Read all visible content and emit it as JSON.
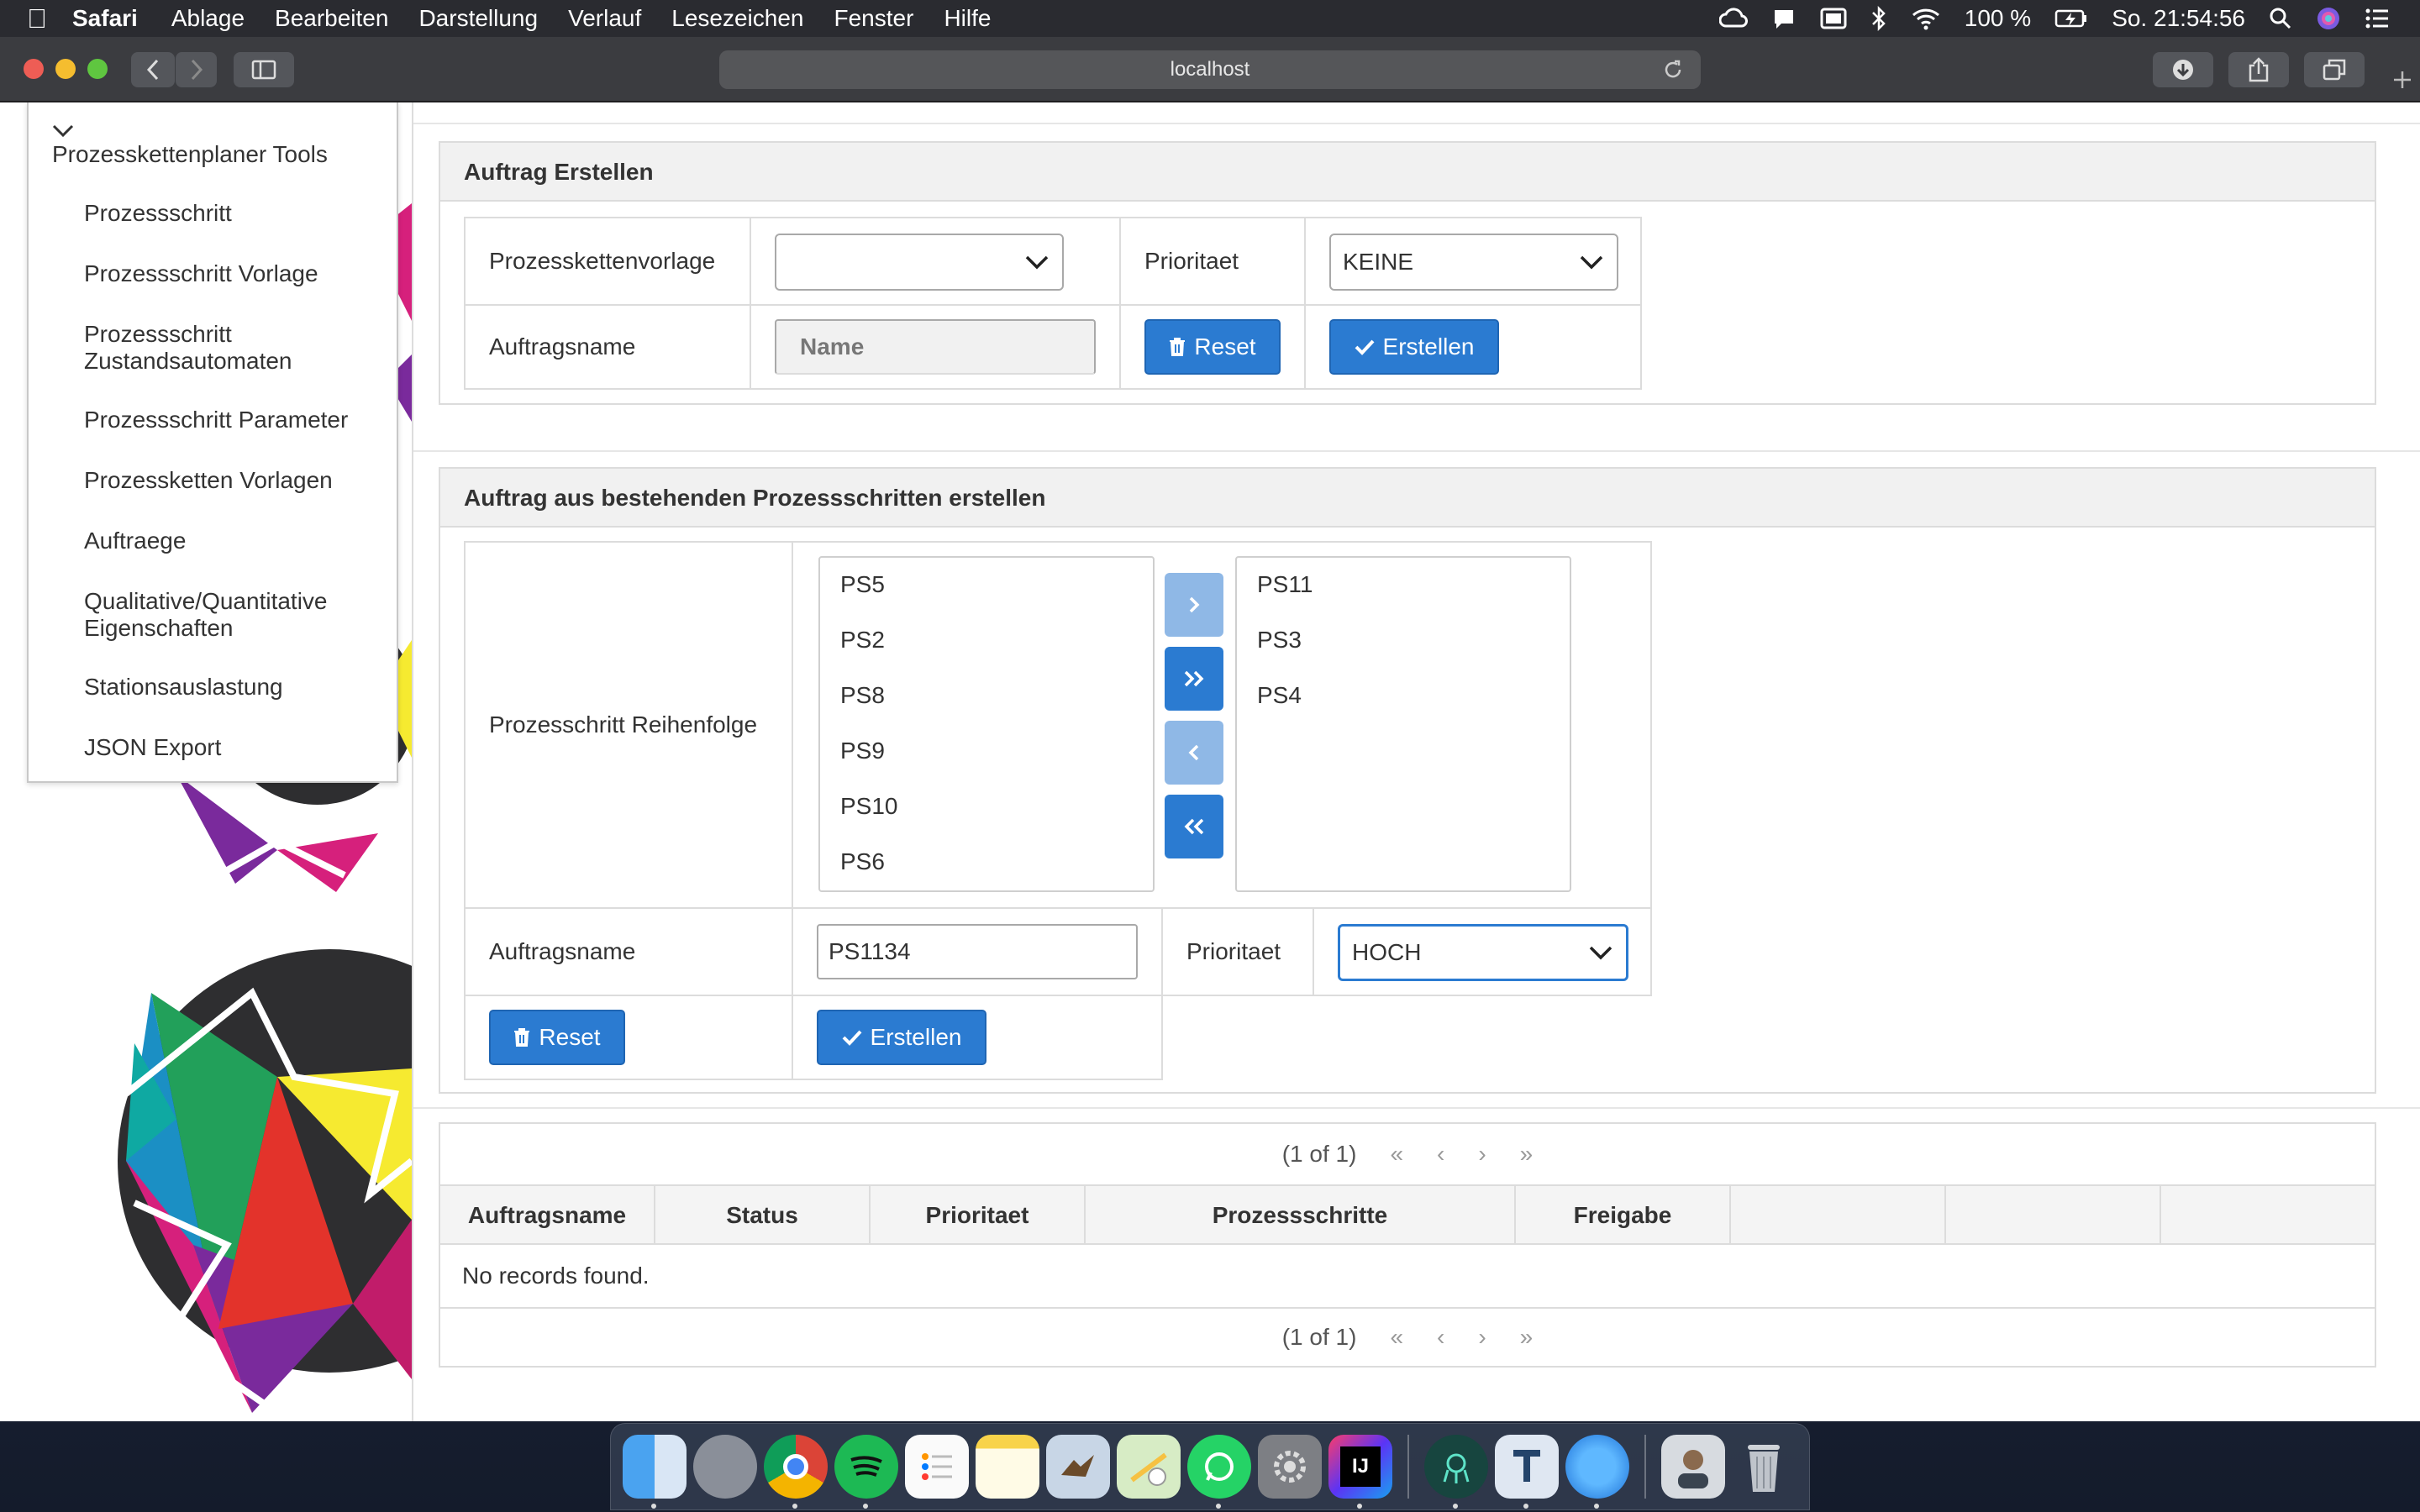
{
  "menubar": {
    "app": "Safari",
    "items": [
      "Ablage",
      "Bearbeiten",
      "Darstellung",
      "Verlauf",
      "Lesezeichen",
      "Fenster",
      "Hilfe"
    ],
    "battery": "100 %",
    "clock": "So. 21:54:56"
  },
  "browser": {
    "url": "localhost"
  },
  "sidebar": {
    "title": "Prozesskettenplaner Tools",
    "items": [
      {
        "label": "Prozessschritt"
      },
      {
        "label": "Prozessschritt Vorlage"
      },
      {
        "label": "Prozessschritt",
        "label2": "Zustandsautomaten"
      },
      {
        "label": "Prozessschritt Parameter"
      },
      {
        "label": "Prozessketten Vorlagen"
      },
      {
        "label": "Auftraege"
      },
      {
        "label": "Qualitative/Quantitative",
        "label2": "Eigenschaften"
      },
      {
        "label": "Stationsauslastung"
      },
      {
        "label": "JSON Export"
      }
    ]
  },
  "panel1": {
    "title": "Auftrag Erstellen",
    "vorlage_label": "Prozesskettenvorlage",
    "vorlage_value": "",
    "prioritaet_label": "Prioritaet",
    "prioritaet_value": "KEINE",
    "auftragsname_label": "Auftragsname",
    "auftragsname_placeholder": "Name",
    "reset_label": "Reset",
    "erstellen_label": "Erstellen"
  },
  "panel2": {
    "title": "Auftrag aus bestehenden Prozessschritten erstellen",
    "reihenfolge_label": "Prozesschritt Reihenfolge",
    "source_list": [
      "PS5",
      "PS2",
      "PS8",
      "PS9",
      "PS10",
      "PS6"
    ],
    "target_list": [
      "PS11",
      "PS3",
      "PS4"
    ],
    "auftragsname_label": "Auftragsname",
    "auftragsname_value": "PS1134",
    "prioritaet_label": "Prioritaet",
    "prioritaet_value": "HOCH",
    "reset_label": "Reset",
    "erstellen_label": "Erstellen"
  },
  "datatable": {
    "pager_text": "(1 of 1)",
    "columns": [
      "Auftragsname",
      "Status",
      "Prioritaet",
      "Prozessschritte",
      "Freigabe",
      "",
      "",
      ""
    ],
    "empty_message": "No records found."
  },
  "dock": {
    "apps": [
      "finder-icon",
      "launchpad-icon",
      "chrome-icon",
      "spotify-icon",
      "reminders-icon",
      "notes-icon",
      "mail-icon",
      "maps-icon",
      "whatsapp-icon",
      "system-preferences-icon",
      "intellij-icon",
      "gitkraken-icon",
      "textwrangler-icon",
      "safari-icon",
      "user-folder-icon",
      "trash-icon"
    ],
    "intellij_text": "IJ"
  },
  "colors": {
    "primary": "#2b7bd1",
    "primary_disabled": "#8fb8e6",
    "panel_header": "#f1f1f1",
    "menubar": "#2a2b30"
  }
}
